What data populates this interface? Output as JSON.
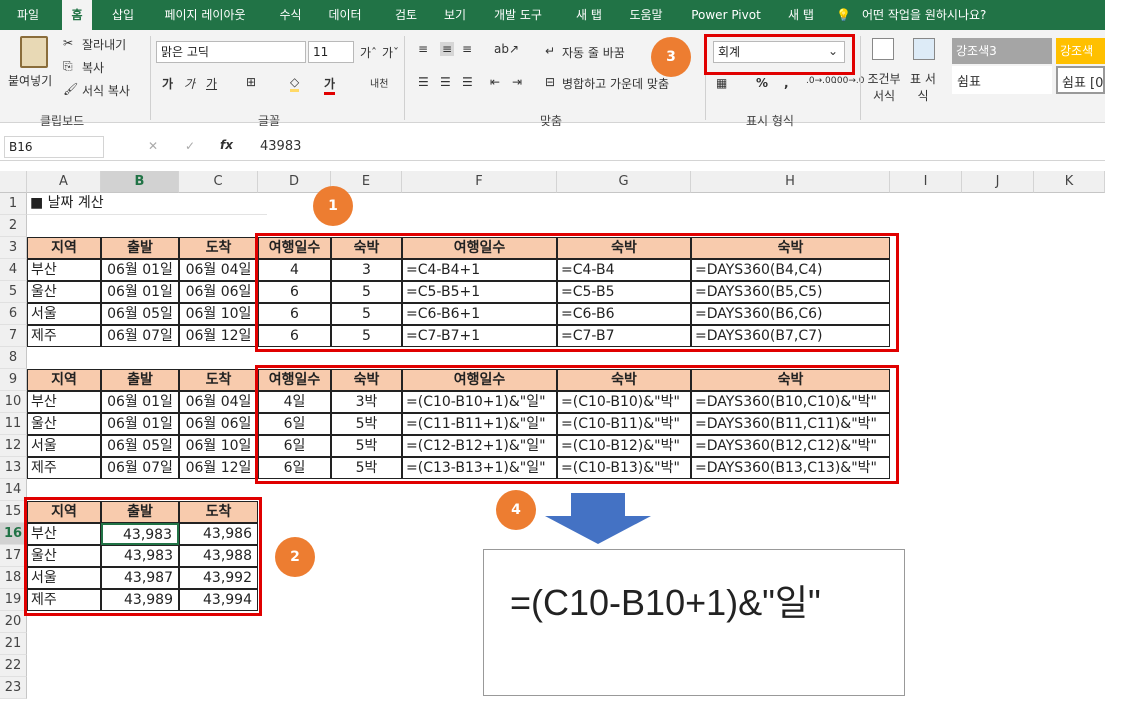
{
  "tabs": [
    "파일",
    "홈",
    "삽입",
    "페이지 레이아웃",
    "수식",
    "데이터",
    "검토",
    "보기",
    "개발 도구",
    "새 탭",
    "도움말",
    "Power Pivot",
    "새 탭"
  ],
  "tell_me": "어떤 작업을 원하시나요?",
  "ribbon": {
    "paste": "붙여넣기",
    "cut": "잘라내기",
    "copy": "복사",
    "format_painter": "서식 복사",
    "clipboard": "클립보드",
    "font_name": "맑은 고딕",
    "font_size": "11",
    "font_group": "글꼴",
    "wrap_text": "자동 줄 바꿈",
    "merge_center": "병합하고 가운데 맞춤",
    "align_group": "맞춤",
    "number_format": "회계",
    "number_group": "표시 형식",
    "cond_format": "조건부 서식",
    "format_table": "표 서식",
    "style1": "강조색3",
    "style2": "강조색",
    "style3": "쉼표",
    "style4": "쉼표 [0]"
  },
  "formula_bar": {
    "name_box": "B16",
    "formula": "43983",
    "fx": "fx"
  },
  "columns": [
    "A",
    "B",
    "C",
    "D",
    "E",
    "F",
    "G",
    "H",
    "I",
    "J",
    "K"
  ],
  "rows": [
    "1",
    "2",
    "3",
    "4",
    "5",
    "6",
    "7",
    "8",
    "9",
    "10",
    "11",
    "12",
    "13",
    "14",
    "15",
    "16",
    "17",
    "18",
    "19",
    "20",
    "21",
    "22",
    "23"
  ],
  "title": "■ 날짜 계산",
  "table1": {
    "headers": [
      "지역",
      "출발",
      "도착",
      "여행일수",
      "숙박",
      "여행일수",
      "숙박",
      "숙박"
    ],
    "rows": [
      [
        "부산",
        "06월 01일",
        "06월 04일",
        "4",
        "3",
        "=C4-B4+1",
        "=C4-B4",
        "=DAYS360(B4,C4)"
      ],
      [
        "울산",
        "06월 01일",
        "06월 06일",
        "6",
        "5",
        "=C5-B5+1",
        "=C5-B5",
        "=DAYS360(B5,C5)"
      ],
      [
        "서울",
        "06월 05일",
        "06월 10일",
        "6",
        "5",
        "=C6-B6+1",
        "=C6-B6",
        "=DAYS360(B6,C6)"
      ],
      [
        "제주",
        "06월 07일",
        "06월 12일",
        "6",
        "5",
        "=C7-B7+1",
        "=C7-B7",
        "=DAYS360(B7,C7)"
      ]
    ]
  },
  "table2": {
    "headers": [
      "지역",
      "출발",
      "도착",
      "여행일수",
      "숙박",
      "여행일수",
      "숙박",
      "숙박"
    ],
    "rows": [
      [
        "부산",
        "06월 01일",
        "06월 04일",
        "4일",
        "3박",
        "=(C10-B10+1)&\"일\"",
        "=(C10-B10)&\"박\"",
        "=DAYS360(B10,C10)&\"박\""
      ],
      [
        "울산",
        "06월 01일",
        "06월 06일",
        "6일",
        "5박",
        "=(C11-B11+1)&\"일\"",
        "=(C10-B11)&\"박\"",
        "=DAYS360(B11,C11)&\"박\""
      ],
      [
        "서울",
        "06월 05일",
        "06월 10일",
        "6일",
        "5박",
        "=(C12-B12+1)&\"일\"",
        "=(C10-B12)&\"박\"",
        "=DAYS360(B12,C12)&\"박\""
      ],
      [
        "제주",
        "06월 07일",
        "06월 12일",
        "6일",
        "5박",
        "=(C13-B13+1)&\"일\"",
        "=(C10-B13)&\"박\"",
        "=DAYS360(B13,C13)&\"박\""
      ]
    ]
  },
  "table3": {
    "headers": [
      "지역",
      "출발",
      "도착"
    ],
    "rows": [
      [
        "부산",
        "43,983",
        "43,986"
      ],
      [
        "울산",
        "43,983",
        "43,988"
      ],
      [
        "서울",
        "43,987",
        "43,992"
      ],
      [
        "제주",
        "43,989",
        "43,994"
      ]
    ]
  },
  "badges": [
    "1",
    "2",
    "3",
    "4"
  ],
  "callout": "=(C10-B10+1)&\"일\"",
  "colors": {
    "accent": "#217346",
    "header_fill": "#f8cbad",
    "highlight": "#e00000",
    "badge": "#ed7d31",
    "arrow": "#4472c4"
  }
}
